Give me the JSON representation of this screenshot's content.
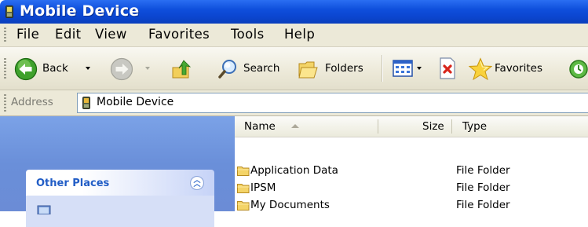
{
  "window": {
    "title": "Mobile Device"
  },
  "menu": [
    "File",
    "Edit",
    "View",
    "Favorites",
    "Tools",
    "Help"
  ],
  "toolbar": {
    "back_label": "Back",
    "search_label": "Search",
    "folders_label": "Folders",
    "favorites_label": "Favorites"
  },
  "address": {
    "label": "Address",
    "value": "Mobile Device"
  },
  "tasks": {
    "other_places_title": "Other Places"
  },
  "list": {
    "columns": {
      "name": "Name",
      "size": "Size",
      "type": "Type"
    },
    "rows": [
      {
        "name": "Application Data",
        "type": "File Folder",
        "icon": "folder-icon"
      },
      {
        "name": "IPSM",
        "type": "File Folder",
        "icon": "folder-icon"
      },
      {
        "name": "My Documents",
        "type": "File Folder",
        "icon": "folder-icon"
      }
    ]
  },
  "colors": {
    "titlebar": "#0b46d0",
    "taskpane": "#6b8cd6",
    "panel_title": "#215dc6"
  }
}
